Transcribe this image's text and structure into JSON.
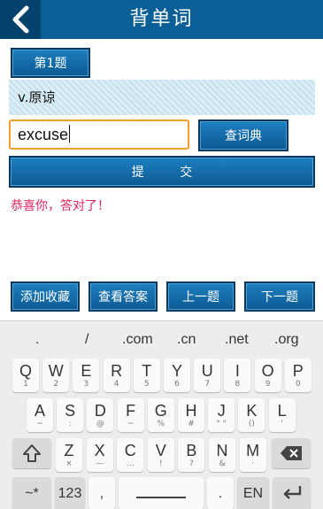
{
  "header": {
    "title": "背单词",
    "back_icon": "chevron-left-icon"
  },
  "quiz": {
    "question_label": "第1题",
    "definition": "v.原谅",
    "answer_value": "excuse",
    "dict_button": "查词典",
    "submit_button": "提 交",
    "result_text": "恭喜你，答对了！"
  },
  "actions": {
    "add_favorite": "添加收藏",
    "view_answer": "查看答案",
    "prev": "上一题",
    "next": "下一题"
  },
  "keyboard": {
    "suggestions": [
      ".",
      "/",
      ".com",
      ".cn",
      ".net",
      ".org"
    ],
    "row1": [
      {
        "k": "Q",
        "s": "1"
      },
      {
        "k": "W",
        "s": "2"
      },
      {
        "k": "E",
        "s": "3"
      },
      {
        "k": "R",
        "s": "4"
      },
      {
        "k": "T",
        "s": "5"
      },
      {
        "k": "Y",
        "s": "6"
      },
      {
        "k": "U",
        "s": "7"
      },
      {
        "k": "I",
        "s": "8"
      },
      {
        "k": "O",
        "s": "9"
      },
      {
        "k": "P",
        "s": "0"
      }
    ],
    "row2": [
      {
        "k": "A",
        "s": "~"
      },
      {
        "k": "S",
        "s": ":"
      },
      {
        "k": "D",
        "s": "@"
      },
      {
        "k": "F",
        "s": "~"
      },
      {
        "k": "G",
        "s": "%"
      },
      {
        "k": "H",
        "s": "#"
      },
      {
        "k": "J",
        "s": "\" \""
      },
      {
        "k": "K",
        "s": "()"
      },
      {
        "k": "L",
        "s": "'"
      }
    ],
    "row3": [
      {
        "k": "Z",
        "s": "×"
      },
      {
        "k": "X",
        "s": "—"
      },
      {
        "k": "C",
        "s": "…"
      },
      {
        "k": "V",
        "s": "!"
      },
      {
        "k": "B",
        "s": "?"
      },
      {
        "k": "N",
        "s": "&"
      },
      {
        "k": "M",
        "s": "·"
      }
    ],
    "bottom": {
      "symbols": "~*",
      "numbers": "123",
      "comma": ",",
      "period": ".",
      "lang": "EN"
    }
  }
}
